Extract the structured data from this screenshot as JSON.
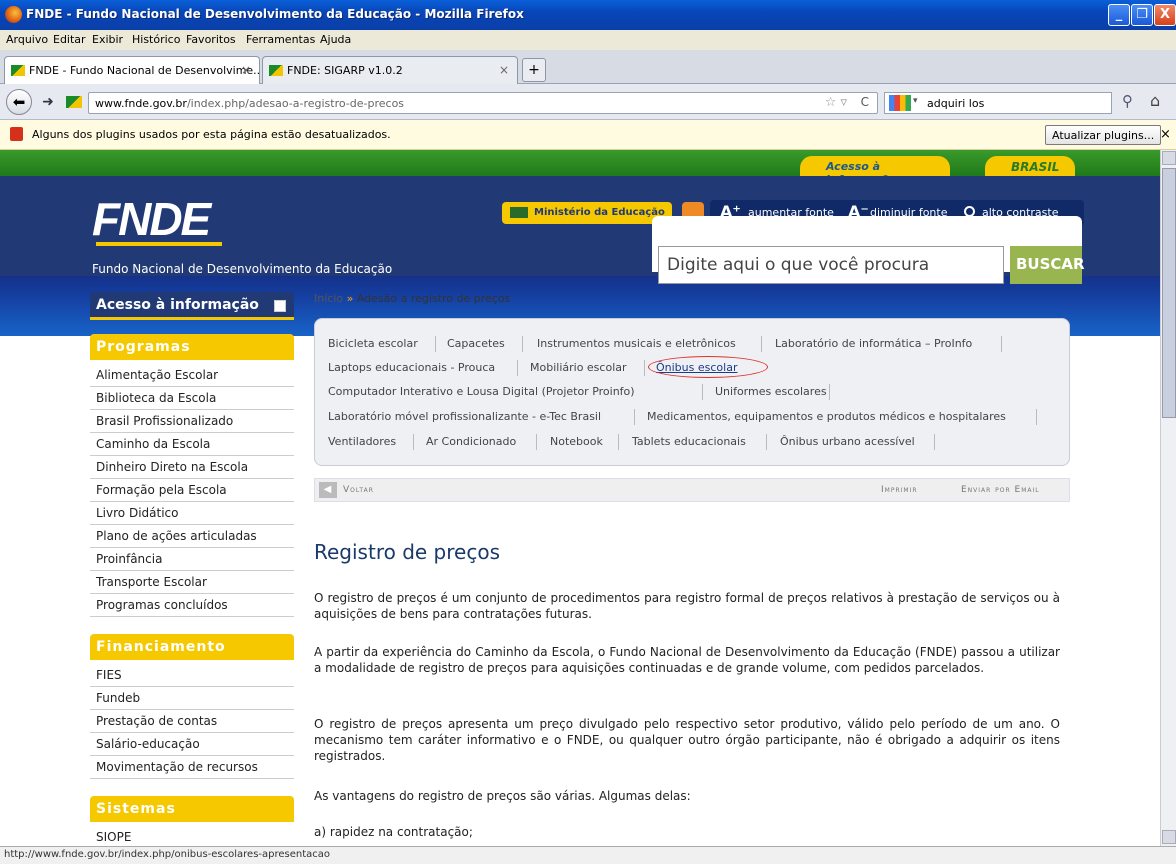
{
  "window": {
    "title": "FNDE - Fundo Nacional de Desenvolvimento da Educação - Mozilla Firefox",
    "minimize": "_",
    "maximize": "❐",
    "close": "X"
  },
  "menu": {
    "items": [
      "Arquivo",
      "Editar",
      "Exibir",
      "Histórico",
      "Favoritos",
      "Ferramentas",
      "Ajuda"
    ]
  },
  "tabs": [
    {
      "label": "FNDE - Fundo Nacional de Desenvolvime...",
      "close": "×"
    },
    {
      "label": "FNDE: SIGARP v1.0.2",
      "close": "×"
    }
  ],
  "newtab": "+",
  "nav": {
    "url_domain": "www.fnde.gov.br",
    "url_path": "/index.php/adesao-a-registro-de-precos",
    "search_value": "adquiri los"
  },
  "plugin": {
    "message": "Alguns dos plugins usados por esta página estão desatualizados.",
    "button": "Atualizar plugins...",
    "close": "×"
  },
  "site": {
    "acesso_info": "Acesso à Informação",
    "brasil": "BRASIL",
    "logo": "FNDE",
    "subtitle": "Fundo Nacional de Desenvolvimento da Educação",
    "ministerio": "Ministério da Educação",
    "a_plus": "A⁺",
    "aumentar": "aumentar fonte",
    "a_minus": "A⁻",
    "diminuir": "diminuir fonte",
    "contraste": "alto contraste",
    "search_placeholder": "Digite aqui o que você procura",
    "buscar": "BUSCAR"
  },
  "sidebar": {
    "acesso": "Acesso à informação",
    "sections": [
      {
        "title": "Programas",
        "items": [
          "Alimentação Escolar",
          "Biblioteca da Escola",
          "Brasil Profissionalizado",
          "Caminho da Escola",
          "Dinheiro Direto na Escola",
          "Formação pela Escola",
          "Livro Didático",
          "Plano de ações articuladas",
          "Proinfância",
          "Transporte Escolar",
          "Programas concluídos"
        ]
      },
      {
        "title": "Financiamento",
        "items": [
          "FIES",
          "Fundeb",
          "Prestação de contas",
          "Salário-educação",
          "Movimentação de recursos"
        ]
      },
      {
        "title": "Sistemas",
        "items": [
          "SIOPE"
        ]
      }
    ]
  },
  "breadcrumb": {
    "home": "Início",
    "arrow": "»",
    "current": "Adesão a registro de preços"
  },
  "categories": [
    [
      "Bicicleta escolar",
      "Capacetes",
      "Instrumentos musicais e eletrônicos",
      "Laboratório de informática – ProInfo"
    ],
    [
      "Laptops educacionais - Prouca",
      "Mobiliário escolar",
      "Ônibus escolar"
    ],
    [
      "Computador Interativo e Lousa Digital (Projetor Proinfo)",
      "Uniformes escolares"
    ],
    [
      "Laboratório móvel profissionalizante - e-Tec Brasil",
      "Medicamentos, equipamentos e produtos médicos e hospitalares"
    ],
    [
      "Ventiladores",
      "Ar Condicionado",
      "Notebook",
      "Tablets educacionais",
      "Ônibus urbano acessível"
    ]
  ],
  "toolbar": {
    "voltar": "Voltar",
    "imprimir": "Imprimir",
    "enviar": "Enviar por Email"
  },
  "article": {
    "title": "Registro de preços",
    "paragraphs": [
      "O registro de preços é um conjunto de procedimentos para registro formal de preços relativos à prestação de serviços ou à aquisições de bens para contratações futuras.",
      "A partir da experiência do Caminho da Escola, o Fundo Nacional de Desenvolvimento da Educação (FNDE) passou a utilizar a modalidade de registro de preços para aquisições continuadas e de grande volume, com pedidos parcelados.",
      "O registro de preços apresenta um preço divulgado pelo respectivo setor produtivo, válido pelo período de um ano. O mecanismo tem caráter informativo e o FNDE, ou qualquer outro órgão participante, não é obrigado a adquirir os itens registrados.",
      "As vantagens do registro de preços são várias. Algumas delas:",
      "a) rapidez na contratação;"
    ]
  },
  "status": {
    "url": "http://www.fnde.gov.br/index.php/onibus-escolares-apresentacao"
  }
}
